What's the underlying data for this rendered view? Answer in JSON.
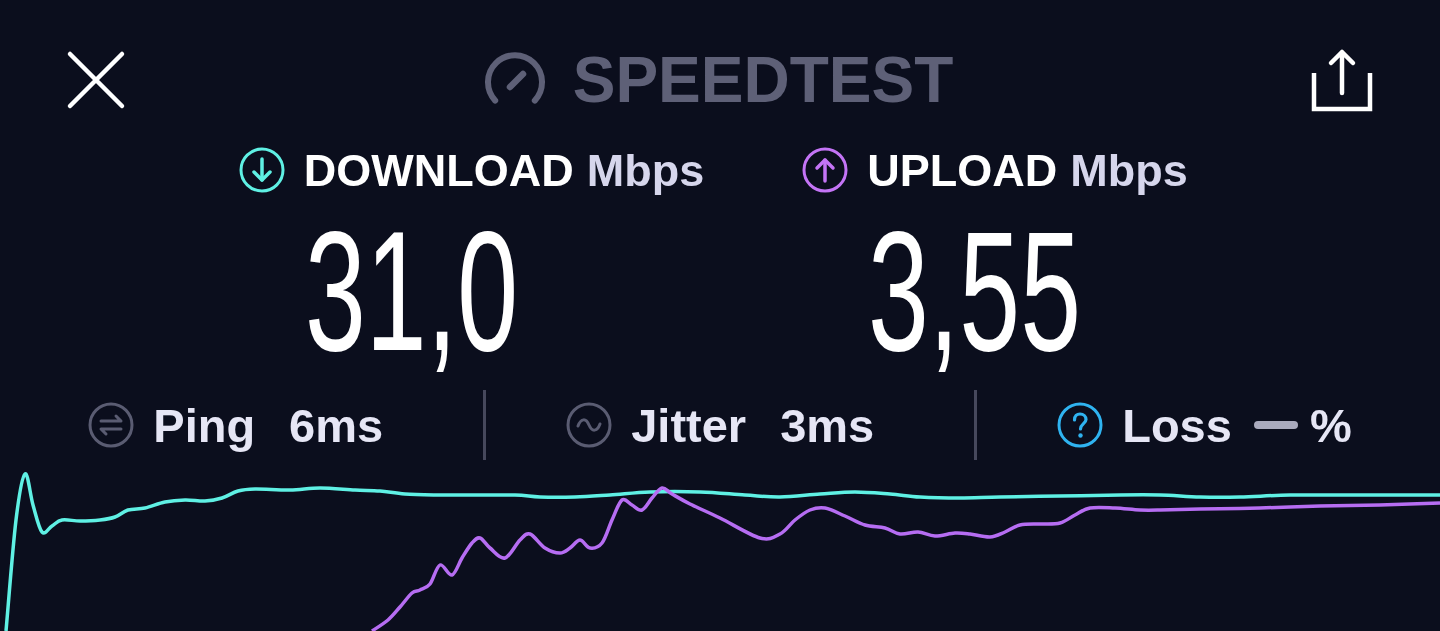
{
  "header": {
    "title": "SPEEDTEST"
  },
  "results": [
    {
      "kind": "download",
      "label": "DOWNLOAD",
      "unit": "Mbps",
      "value": "31,0"
    },
    {
      "kind": "upload",
      "label": "UPLOAD",
      "unit": "Mbps",
      "value": "3,55"
    }
  ],
  "stats": [
    {
      "kind": "ping",
      "label": "Ping",
      "value": "6ms"
    },
    {
      "kind": "jitter",
      "label": "Jitter",
      "value": "3ms"
    },
    {
      "kind": "loss",
      "label": "Loss",
      "unit": "%"
    }
  ]
}
